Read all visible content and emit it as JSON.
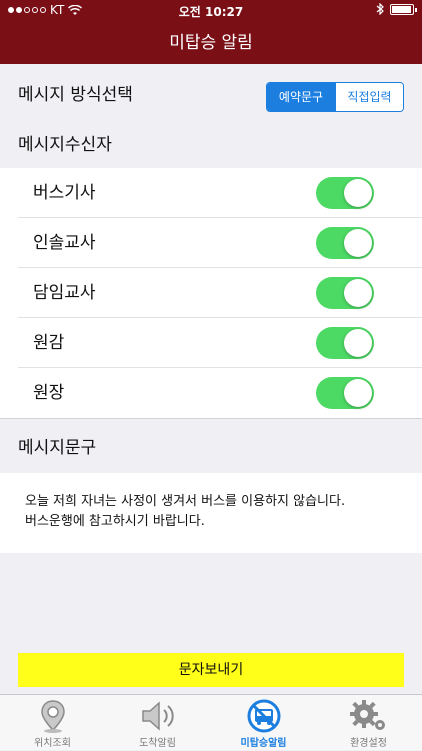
{
  "status_bar": {
    "carrier": "KT",
    "time": "오전 10:27"
  },
  "nav": {
    "title": "미탑승 알림"
  },
  "message_mode": {
    "label": "메시지 방식선택",
    "options": [
      "예약문구",
      "직접입력"
    ],
    "selected": "예약문구"
  },
  "recipients": {
    "header": "메시지수신자",
    "items": [
      {
        "label": "버스기사",
        "on": true
      },
      {
        "label": "인솔교사",
        "on": true
      },
      {
        "label": "담임교사",
        "on": true
      },
      {
        "label": "원감",
        "on": true
      },
      {
        "label": "원장",
        "on": true
      }
    ]
  },
  "message": {
    "header": "메시지문구",
    "line1": "오늘 저희 자녀는 사정이 생겨서 버스를 이용하지 않습니다.",
    "line2": "버스운행에 참고하시기 바랍니다."
  },
  "send_button": {
    "label": "문자보내기"
  },
  "tabs": [
    {
      "label": "위치조회",
      "icon": "location-pin-icon"
    },
    {
      "label": "도착알림",
      "icon": "speaker-icon"
    },
    {
      "label": "미탑승알림",
      "icon": "bus-no-icon",
      "active": true
    },
    {
      "label": "환경설정",
      "icon": "gear-icon"
    }
  ],
  "colors": {
    "brand": "#7a0f16",
    "accent": "#1c7fe0",
    "toggle_on": "#4cd964",
    "send_button": "#ffff1a"
  }
}
